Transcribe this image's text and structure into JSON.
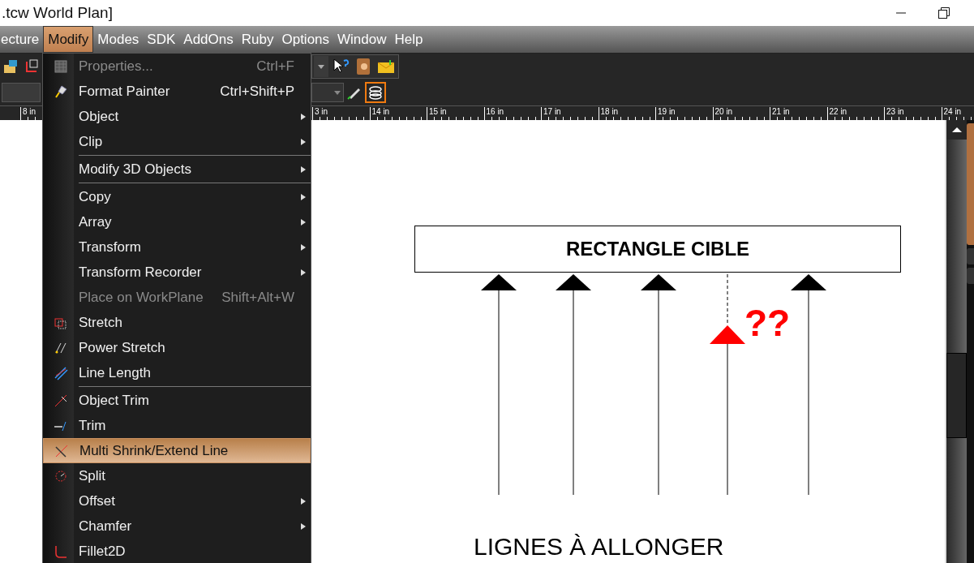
{
  "window": {
    "title": ".tcw World Plan]"
  },
  "menu_bar": [
    {
      "label": "ecture",
      "selected": false
    },
    {
      "label": "Modify",
      "selected": true
    },
    {
      "label": "Modes",
      "selected": false
    },
    {
      "label": "SDK",
      "selected": false
    },
    {
      "label": "AddOns",
      "selected": false
    },
    {
      "label": "Ruby",
      "selected": false
    },
    {
      "label": "Options",
      "selected": false
    },
    {
      "label": "Window",
      "selected": false
    },
    {
      "label": "Help",
      "selected": false
    }
  ],
  "ruler": [
    "8 in",
    "3 in",
    "14 in",
    "15 in",
    "16 in",
    "17 in",
    "18 in",
    "19 in",
    "20 in",
    "21 in",
    "22 in",
    "23 in",
    "24 in"
  ],
  "menu": [
    {
      "kind": "item",
      "label": "Properties...",
      "shortcut": "Ctrl+F",
      "submenu": false,
      "disabled": true,
      "selected": false
    },
    {
      "kind": "item",
      "label": "Format Painter",
      "shortcut": "Ctrl+Shift+P",
      "submenu": false,
      "disabled": false,
      "selected": false
    },
    {
      "kind": "item",
      "label": "Object",
      "submenu": true,
      "disabled": false,
      "selected": false
    },
    {
      "kind": "item",
      "label": "Clip",
      "submenu": true,
      "disabled": false,
      "selected": false
    },
    {
      "kind": "separator"
    },
    {
      "kind": "item",
      "label": "Modify 3D Objects",
      "submenu": true,
      "disabled": false,
      "selected": false
    },
    {
      "kind": "separator"
    },
    {
      "kind": "item",
      "label": "Copy",
      "submenu": true,
      "disabled": false,
      "selected": false
    },
    {
      "kind": "item",
      "label": "Array",
      "submenu": true,
      "disabled": false,
      "selected": false
    },
    {
      "kind": "item",
      "label": "Transform",
      "submenu": true,
      "disabled": false,
      "selected": false
    },
    {
      "kind": "item",
      "label": "Transform Recorder",
      "submenu": true,
      "disabled": false,
      "selected": false
    },
    {
      "kind": "item",
      "label": "Place on WorkPlane",
      "shortcut": "Shift+Alt+W",
      "submenu": false,
      "disabled": true,
      "selected": false
    },
    {
      "kind": "item",
      "label": "Stretch",
      "submenu": false,
      "disabled": false,
      "selected": false
    },
    {
      "kind": "item",
      "label": "Power Stretch",
      "submenu": false,
      "disabled": false,
      "selected": false
    },
    {
      "kind": "item",
      "label": "Line Length",
      "submenu": false,
      "disabled": false,
      "selected": false
    },
    {
      "kind": "separator"
    },
    {
      "kind": "item",
      "label": "Object Trim",
      "submenu": false,
      "disabled": false,
      "selected": false
    },
    {
      "kind": "item",
      "label": "Trim",
      "submenu": false,
      "disabled": false,
      "selected": false
    },
    {
      "kind": "item",
      "label": "Multi Shrink/Extend Line",
      "submenu": false,
      "disabled": false,
      "selected": true
    },
    {
      "kind": "item",
      "label": "Split",
      "submenu": false,
      "disabled": false,
      "selected": false
    },
    {
      "kind": "item",
      "label": "Offset",
      "submenu": true,
      "disabled": false,
      "selected": false
    },
    {
      "kind": "item",
      "label": "Chamfer",
      "submenu": true,
      "disabled": false,
      "selected": false
    },
    {
      "kind": "item",
      "label": "Fillet2D",
      "submenu": false,
      "disabled": false,
      "selected": false
    }
  ],
  "canvas": {
    "rectangle_label": "RECTANGLE CIBLE",
    "question": "??",
    "caption": "LIGNES À ALLONGER"
  }
}
